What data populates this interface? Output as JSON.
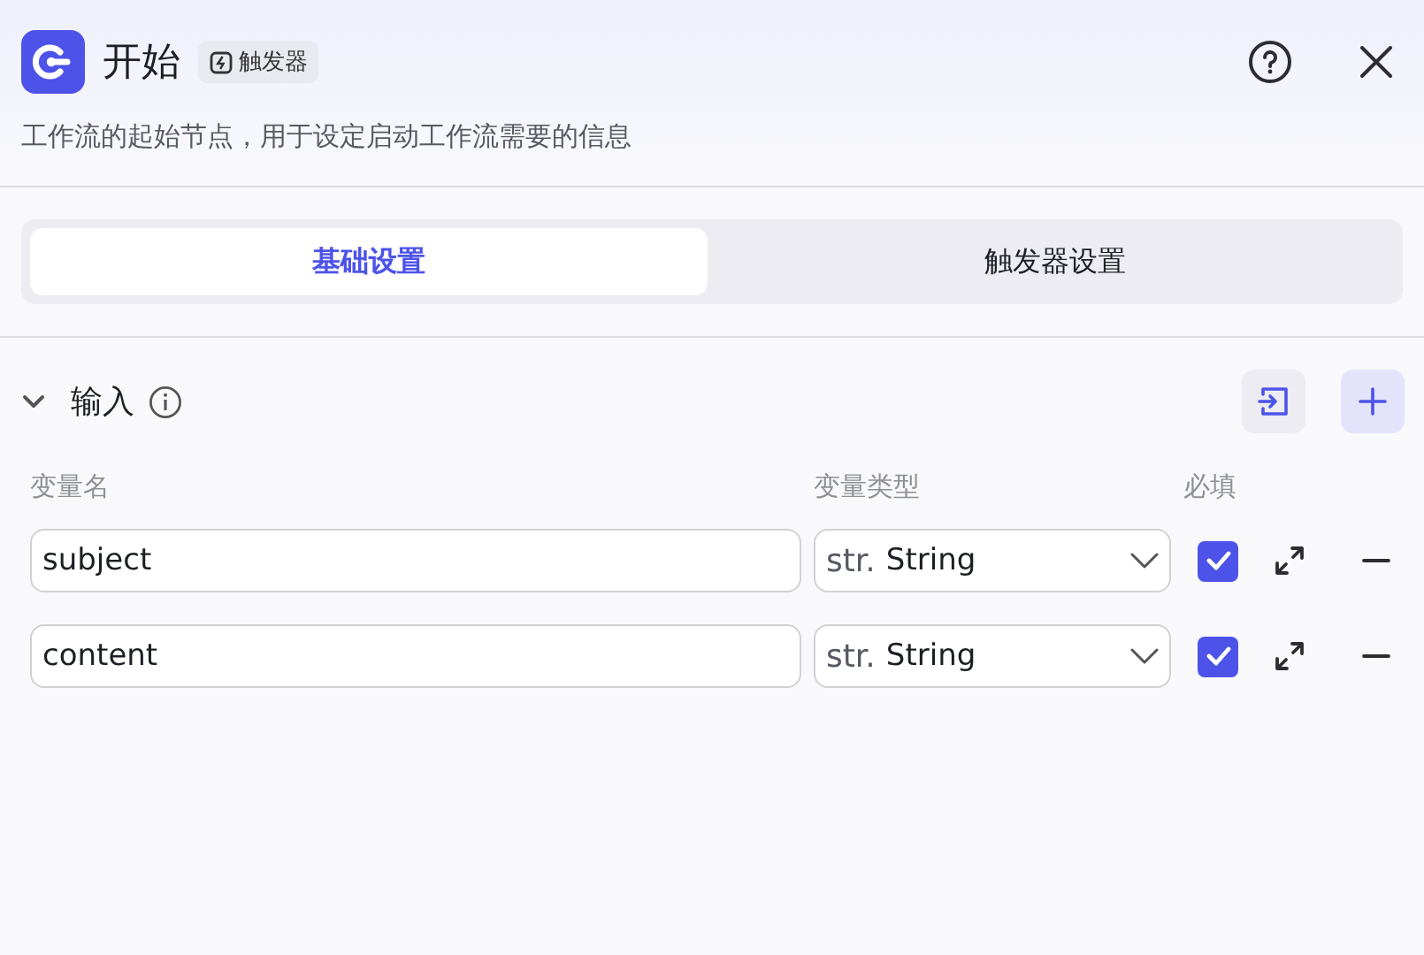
{
  "header": {
    "title": "开始",
    "badge": "触发器",
    "description": "工作流的起始节点，用于设定启动工作流需要的信息"
  },
  "tabs": [
    {
      "label": "基础设置",
      "selected": true
    },
    {
      "label": "触发器设置",
      "selected": false
    }
  ],
  "section": {
    "title": "输入",
    "expanded": true,
    "columns": [
      "变量名",
      "变量类型",
      "必填"
    ],
    "rows": [
      {
        "name": "subject",
        "type_prefix": "str.",
        "type": "String",
        "required": true
      },
      {
        "name": "content",
        "type_prefix": "str.",
        "type": "String",
        "required": true
      }
    ]
  }
}
